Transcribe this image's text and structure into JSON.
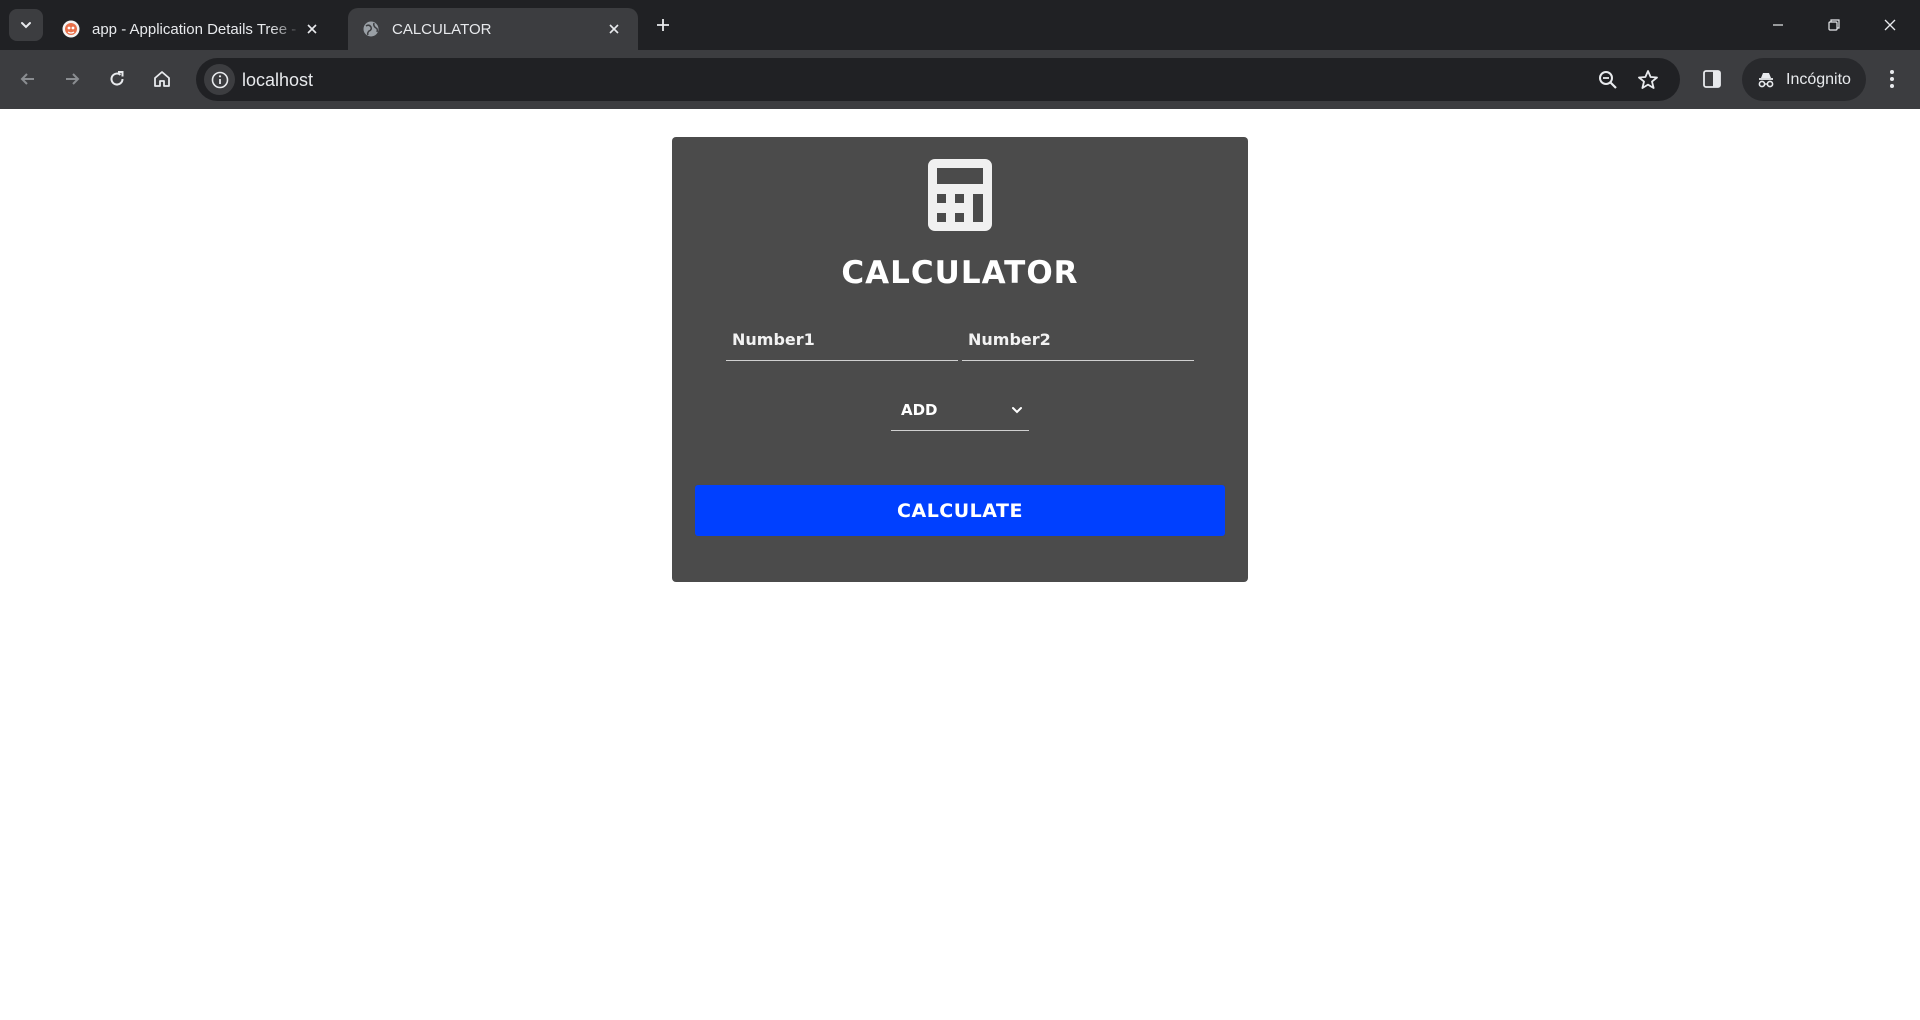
{
  "browser": {
    "tabs": [
      {
        "title": "app - Application Details Tree -",
        "active": false,
        "favicon": "app-logo-icon"
      },
      {
        "title": "CALCULATOR",
        "active": true,
        "favicon": "globe-icon"
      }
    ],
    "url": "localhost",
    "incognito_label": "Incógnito"
  },
  "calculator": {
    "title": "CALCULATOR",
    "icon": "calculator-icon",
    "number1_placeholder": "Number1",
    "number2_placeholder": "Number2",
    "operation_selected": "ADD",
    "calculate_label": "CALCULATE",
    "colors": {
      "card_bg": "#4b4b4b",
      "button_bg": "#0040ff",
      "text": "#ffffff"
    }
  }
}
